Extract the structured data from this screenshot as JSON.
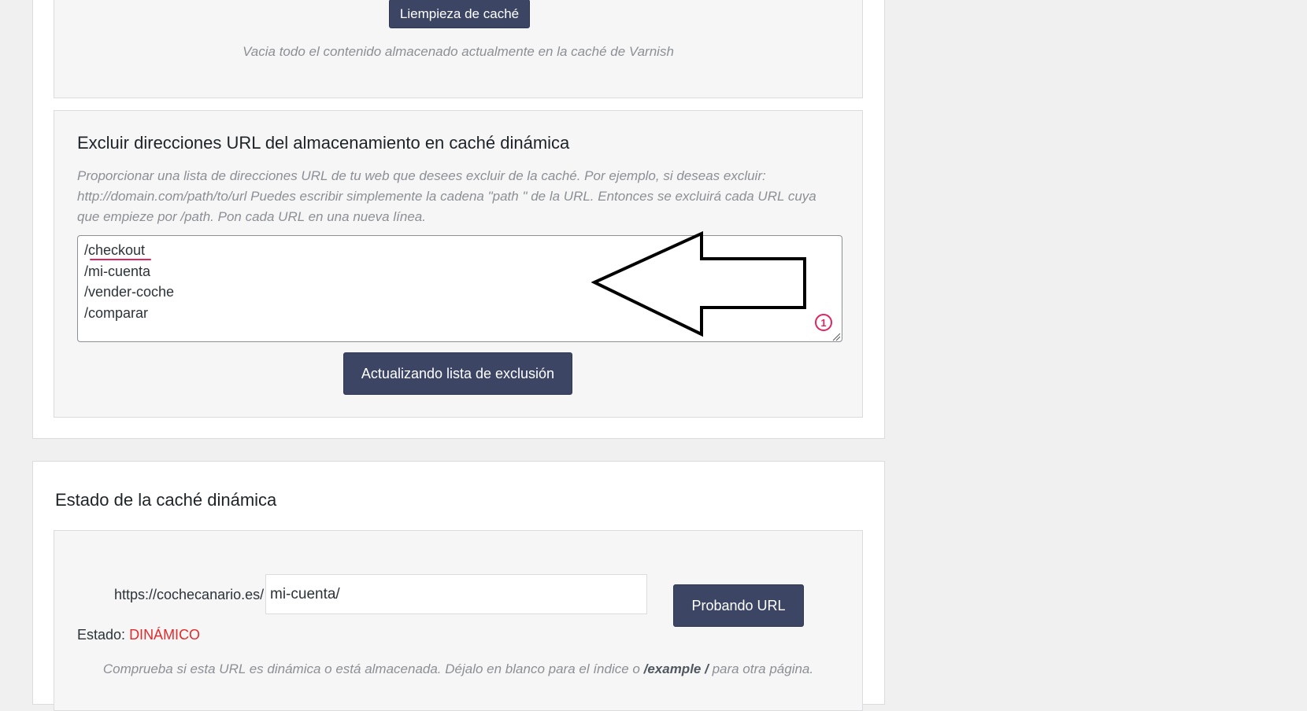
{
  "purge": {
    "button_label": "Liempieza de caché",
    "description": "Vacia todo el contenido almacenado actualmente en la caché de Varnish"
  },
  "exclude": {
    "title": "Excluir direcciones URL del almacenamiento en caché dinámica",
    "description": "Proporcionar una lista de direcciones URL de tu web que desees excluir de la caché. Por ejemplo, si deseas excluir: http://domain.com/path/to/url Puedes escribir simplemente la cadena \"path \" de la URL. Entonces se excluirá cada URL cuya que empieze por /path. Pon cada URL en una nueva línea.",
    "textarea_value": "/checkout\n/mi-cuenta\n/vender-coche\n/comparar",
    "button_label": "Actualizando lista de exclusión",
    "annotation_number": "1"
  },
  "status": {
    "title": "Estado de la caché dinámica",
    "url_prefix": "https://cochecanario.es/",
    "url_value": "mi-cuenta/",
    "test_button_label": "Probando URL",
    "state_label": "Estado:",
    "state_value": "DINÁMICO",
    "help_before": "Comprueba si esta URL es dinámica o está almacenada. Déjalo en blanco para el índice o",
    "help_example": "/example /",
    "help_after": "para otra página."
  },
  "colors": {
    "button_bg": "#3c4664",
    "state_dynamic": "#e02b2b",
    "annotation_red": "#e0245e"
  }
}
